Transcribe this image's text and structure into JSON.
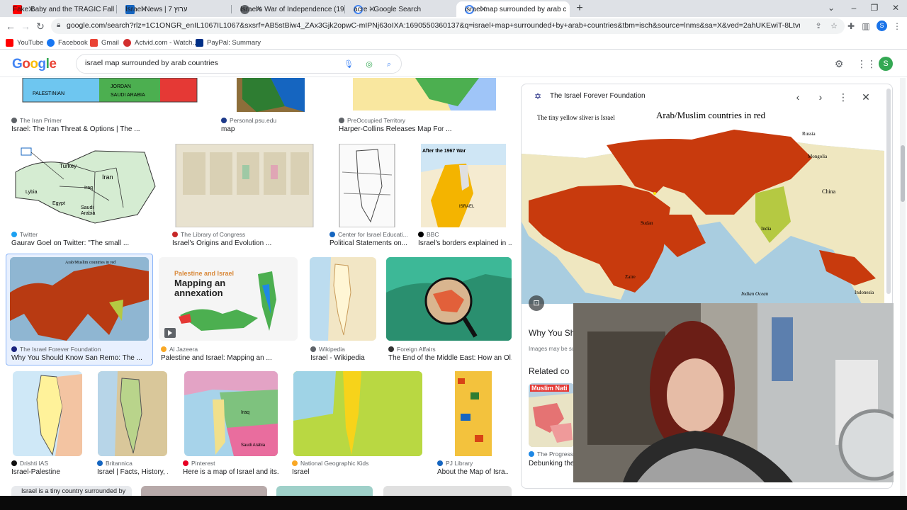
{
  "tabs": [
    {
      "title": "Fake Baby and the TRAGIC Fall o",
      "favicon_color": "#ff0000"
    },
    {
      "title": "Israel News | 7 ערוץ",
      "favicon_color": "#1565c0"
    },
    {
      "title": "Israel's War of Independence (19",
      "favicon_color": "#5f6368"
    },
    {
      "title": "acre - Google Search",
      "favicon_color": "#4285f4"
    },
    {
      "title": "israel map surrounded by arab c",
      "favicon_color": "#4285f4"
    }
  ],
  "browser": {
    "url": "google.com/search?rlz=1C1ONGR_enIL1067IL1067&sxsrf=AB5stBiw4_ZAx3Gjk2opwC-mIPNj63oIXA:1690550360137&q=israel+map+surrounded+by+arab+countries&tbm=isch&source=lnms&sa=X&ved=2ahUKEwiT-8LtvrGAAxVVhv0HHe_gCIYQ0pQJe..."
  },
  "bookmarks": [
    {
      "label": "YouTube",
      "color": "#ff0000"
    },
    {
      "label": "Facebook",
      "color": "#1877f2"
    },
    {
      "label": "Gmail",
      "color": "#ea4335"
    },
    {
      "label": "Actvid.com - Watch...",
      "color": "#d32f2f"
    },
    {
      "label": "PayPal: Summary",
      "color": "#003087"
    }
  ],
  "google": {
    "logo_letters": [
      "G",
      "o",
      "o",
      "g",
      "l",
      "e"
    ],
    "query": "israel map surrounded by arab countries",
    "user_initial": "S",
    "profile_initial": "S"
  },
  "results": [
    {
      "source": "The Iran Primer",
      "title": "Israel: The Iran Threat & Options | The ..."
    },
    {
      "source": "Personal.psu.edu",
      "title": "map"
    },
    {
      "source": "PreOccupied Territory",
      "title": "Harper-Collins Releases Map For ..."
    },
    {
      "source": "Twitter",
      "title": "Gaurav Goel on Twitter: \"The small ..."
    },
    {
      "source": "The Library of Congress",
      "title": "Israel's Origins and Evolution ..."
    },
    {
      "source": "Center for Israel Educati...",
      "title": "Political Statements on..."
    },
    {
      "source": "BBC",
      "title": "Israel's borders explained in ..."
    },
    {
      "source": "The Israel Forever Foundation",
      "title": "Why You Should Know San Remo: The ..."
    },
    {
      "source": "Al Jazeera",
      "title": "Palestine and Israel: Mapping an ..."
    },
    {
      "source": "Wikipedia",
      "title": "Israel - Wikipedia"
    },
    {
      "source": "Foreign Affairs",
      "title": "The End of the Middle East: How an Ol..."
    },
    {
      "source": "Drishti IAS",
      "title": "Israel-Palestine"
    },
    {
      "source": "Britannica",
      "title": "Israel | Facts, History, ..."
    },
    {
      "source": "Pinterest",
      "title": "Here is a map of Israel and its..."
    },
    {
      "source": "National Geographic Kids",
      "title": "Israel"
    },
    {
      "source": "PJ Library",
      "title": "About the Map of Isra..."
    }
  ],
  "thumb_text": {
    "aljazeera_heading": "Palestine and Israel",
    "aljazeera_title": "Mapping an annexation",
    "bottom_caption": "Israel is a tiny country surrounded by",
    "bbc_heading": "After the 1967 War"
  },
  "preview": {
    "source": "The Israel Forever Foundation",
    "caption_left": "The tiny yellow sliver is Israel",
    "caption_right": "Arab/Muslim countries in red",
    "map_labels": [
      "Russia",
      "Mongolia",
      "China",
      "India",
      "Indian Ocean",
      "Indonesia",
      "Zaire",
      "Sudan"
    ],
    "title": "Why You Sh",
    "note": "Images may be su",
    "related_heading": "Related co",
    "related_thumb_label": "Muslim Nati",
    "related_source": "The Progressiv",
    "related_title": "Debunking the"
  }
}
